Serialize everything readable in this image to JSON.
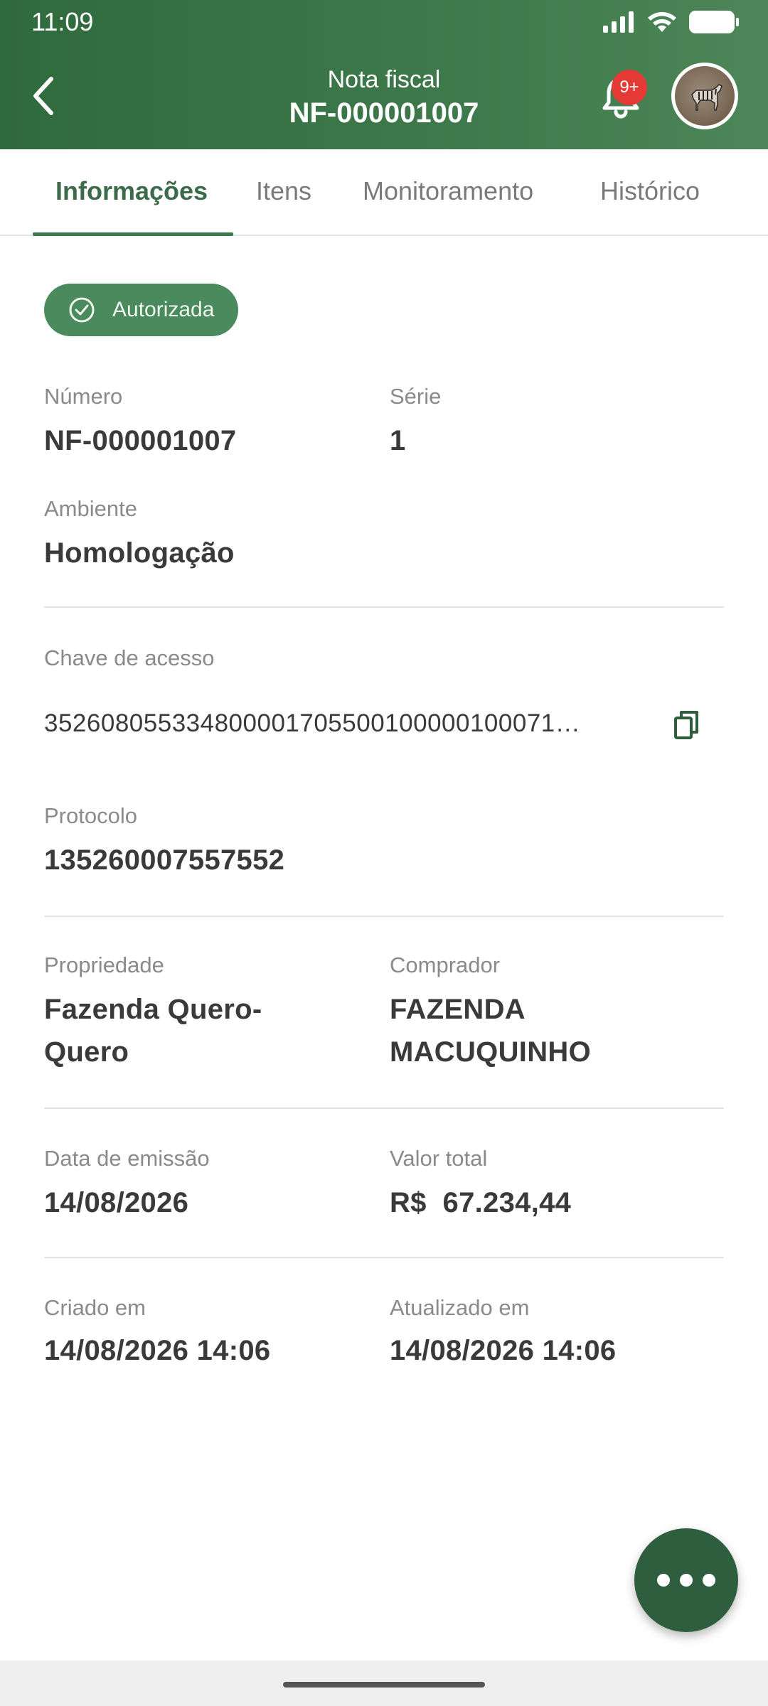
{
  "status_bar": {
    "time": "11:09"
  },
  "header": {
    "subtitle": "Nota fiscal",
    "title": "NF-000001007",
    "notification_count": "9+"
  },
  "tabs": [
    {
      "label": "Informações",
      "active": true
    },
    {
      "label": "Itens",
      "active": false
    },
    {
      "label": "Monitoramento",
      "active": false
    },
    {
      "label": "Histórico",
      "active": false
    }
  ],
  "status": {
    "label": "Autorizada",
    "color": "#4b8a5c"
  },
  "fields": {
    "numero": {
      "label": "Número",
      "value": "NF-000001007"
    },
    "serie": {
      "label": "Série",
      "value": "1"
    },
    "ambiente": {
      "label": "Ambiente",
      "value": "Homologação"
    },
    "chave": {
      "label": "Chave de acesso",
      "value": "352608055334800001705500100000100071…"
    },
    "protocolo": {
      "label": "Protocolo",
      "value": "135260007557552"
    },
    "propriedade": {
      "label": "Propriedade",
      "value_line1": "Fazenda Quero-",
      "value_line2": "Quero"
    },
    "comprador": {
      "label": "Comprador",
      "value_line1": "FAZENDA",
      "value_line2": "MACUQUINHO"
    },
    "data_emissao": {
      "label": "Data de emissão",
      "value": "14/08/2026"
    },
    "valor_total": {
      "label": "Valor total",
      "value": "R$  67.234,44"
    },
    "criado_em": {
      "label": "Criado em",
      "value": "14/08/2026 14:06"
    },
    "atualizado_em": {
      "label": "Atualizado em",
      "value": "14/08/2026 14:06"
    }
  },
  "colors": {
    "header": "#3e7a4b",
    "accent": "#3b6b4a",
    "fab": "#2f5e3e",
    "badge": "#e53935"
  },
  "icons": {
    "back": "chevron-left-icon",
    "notifications": "bell-icon",
    "copy": "copy-icon",
    "status": "check-circle-icon",
    "fab": "more-horizontal-icon"
  }
}
